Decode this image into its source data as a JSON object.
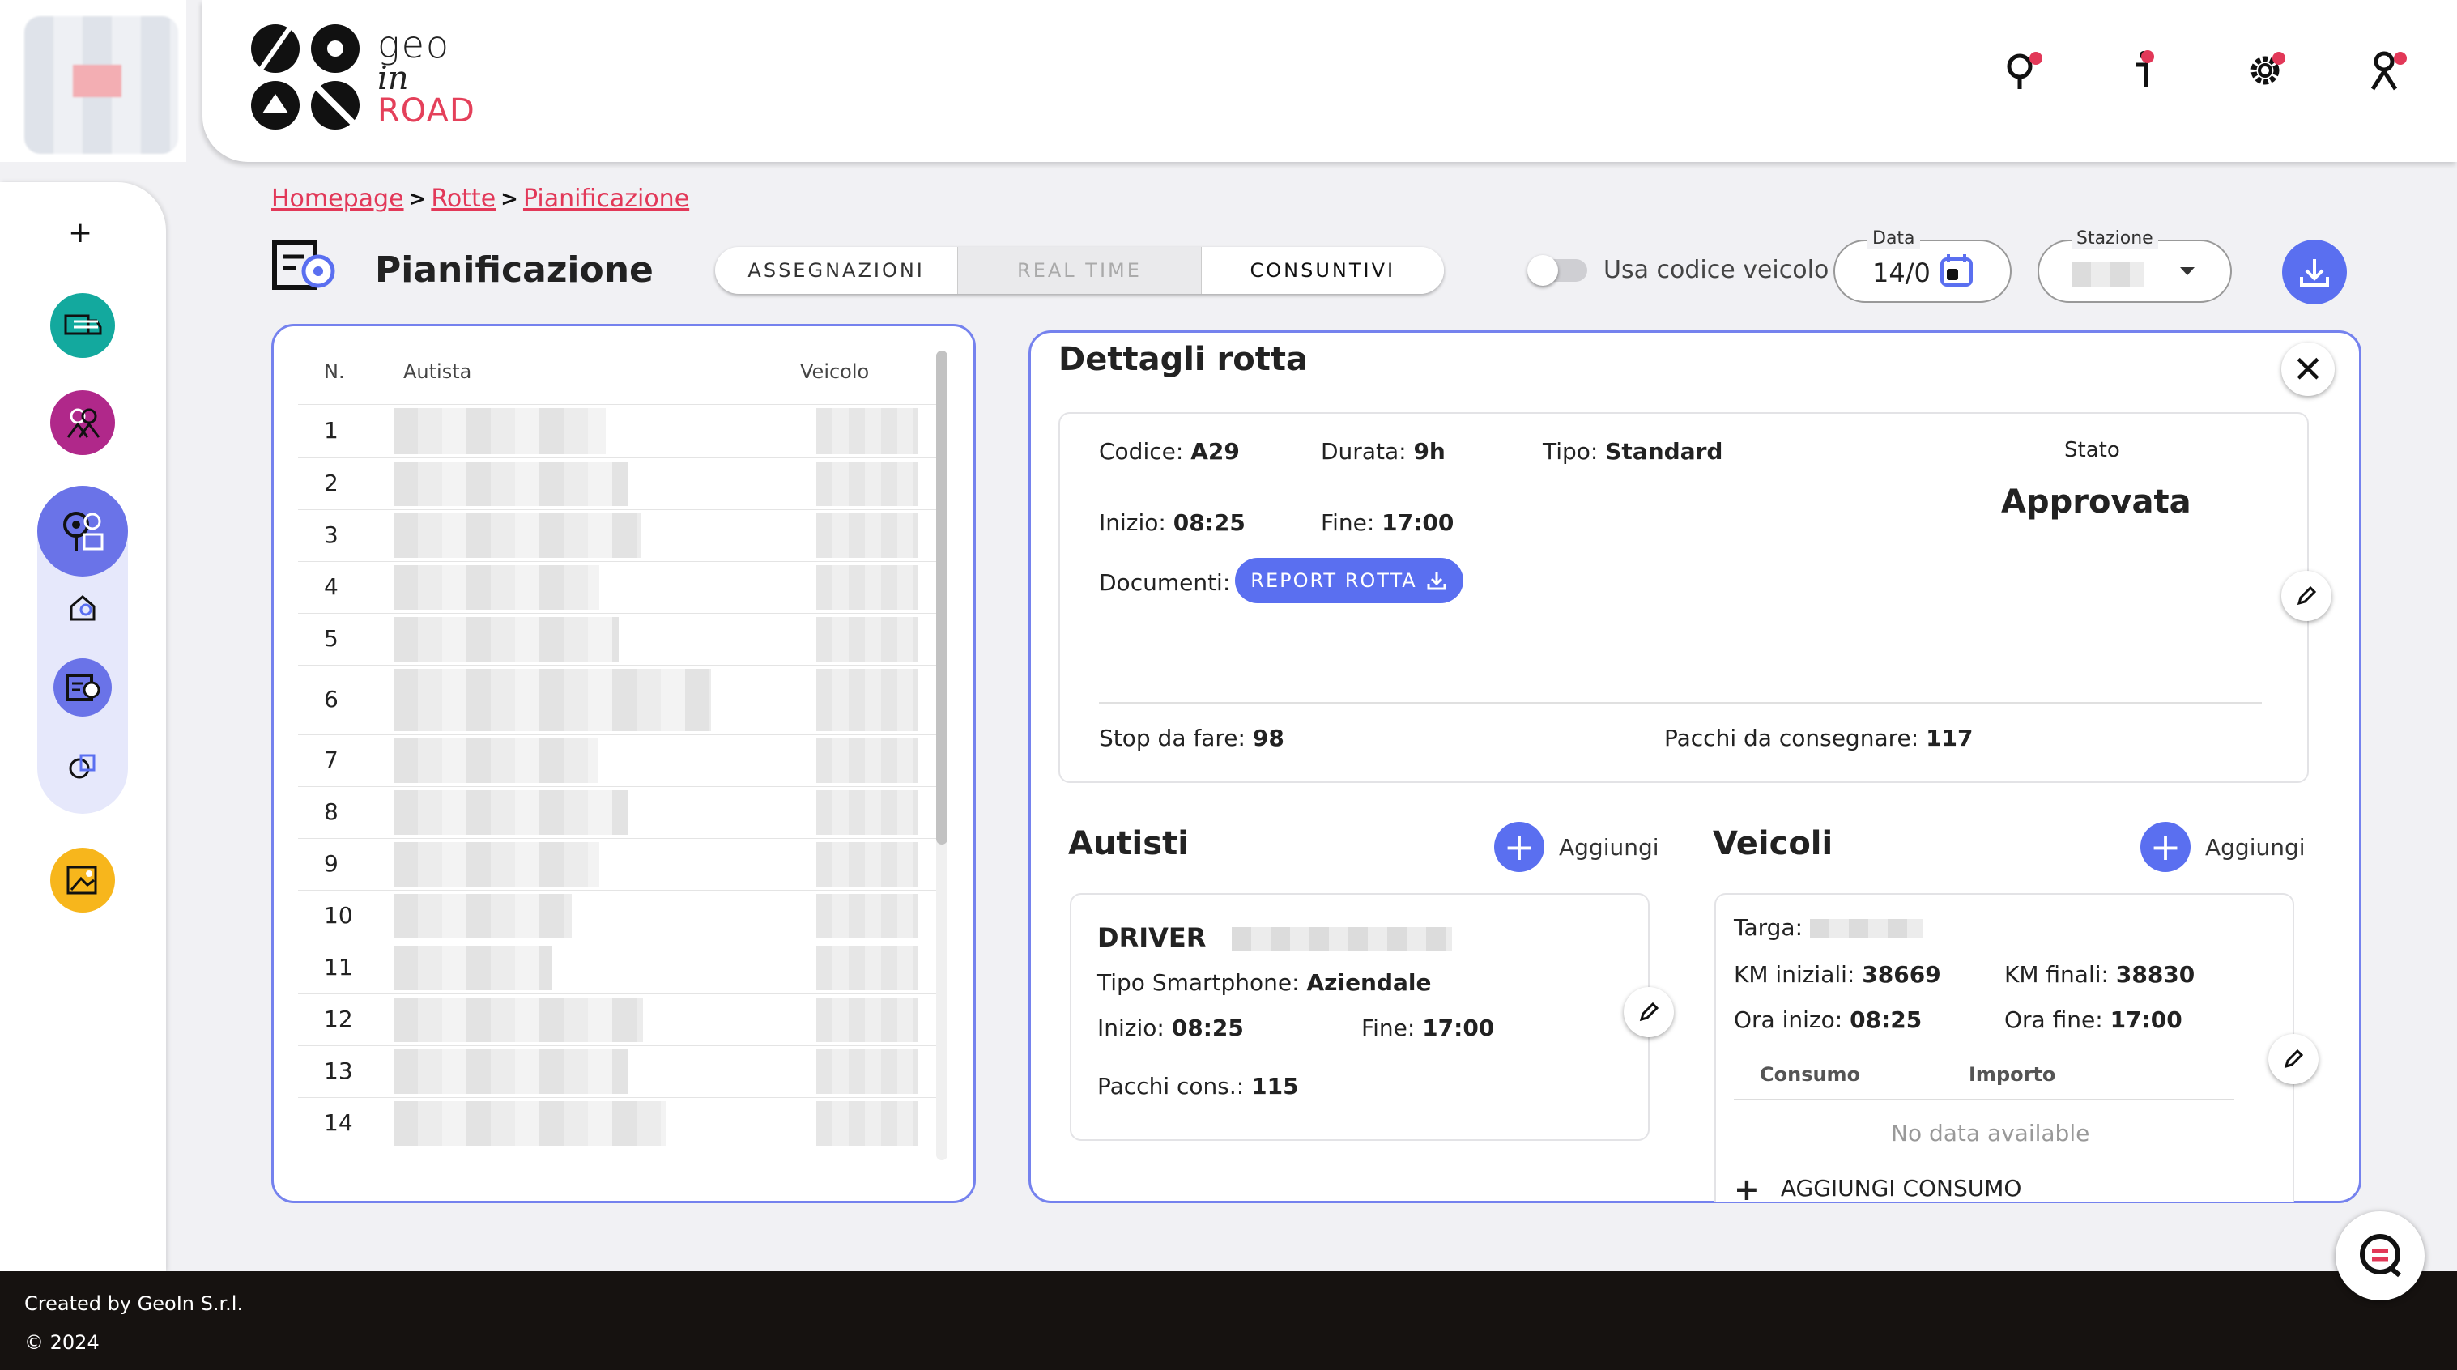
{
  "brand": {
    "geo": "GEO",
    "in": "in",
    "road": "ROAD"
  },
  "header": {
    "icons": [
      "map-pin-icon",
      "info-icon",
      "settings-gear-icon",
      "user-icon"
    ]
  },
  "sidebar": {
    "plus": "+",
    "items": [
      "truck-list-icon",
      "users-icon",
      "route-planning-icon",
      "home-route-icon",
      "route-list-icon",
      "route-report-icon",
      "image-icon"
    ]
  },
  "breadcrumb": {
    "items": [
      "Homepage",
      "Rotte",
      "Pianificazione"
    ],
    "separator": ">"
  },
  "page": {
    "title": "Pianificazione",
    "tabs": [
      {
        "label": "ASSEGNAZIONI",
        "state": "normal"
      },
      {
        "label": "REAL TIME",
        "state": "disabled"
      },
      {
        "label": "CONSUNTIVI",
        "state": "active"
      }
    ],
    "toggle_label": "Usa codice veicolo",
    "date": {
      "label": "Data",
      "value": "14/0"
    },
    "station": {
      "label": "Stazione",
      "value": ""
    }
  },
  "table": {
    "headers": {
      "n": "N.",
      "driver": "Autista",
      "vehicle": "Veicolo"
    },
    "rows": [
      "1",
      "2",
      "3",
      "4",
      "5",
      "6",
      "7",
      "8",
      "9",
      "10",
      "11",
      "12",
      "13",
      "14"
    ]
  },
  "details": {
    "title": "Dettagli rotta",
    "code_label": "Codice:",
    "code": "A29",
    "duration_label": "Durata:",
    "duration": "9h",
    "type_label": "Tipo:",
    "type": "Standard",
    "status_label": "Stato",
    "status": "Approvata",
    "start_label": "Inizio:",
    "start": "08:25",
    "end_label": "Fine:",
    "end": "17:00",
    "docs_label": "Documenti:",
    "report_button": "REPORT ROTTA",
    "stops_label": "Stop da fare:",
    "stops": "98",
    "parcels_label": "Pacchi da consegnare:",
    "parcels": "117"
  },
  "drivers": {
    "title": "Autisti",
    "add_label": "Aggiungi",
    "card": {
      "role": "DRIVER",
      "phone_label": "Tipo Smartphone:",
      "phone": "Aziendale",
      "start_label": "Inizio:",
      "start": "08:25",
      "end_label": "Fine:",
      "end": "17:00",
      "parcels_label": "Pacchi cons.:",
      "parcels": "115"
    }
  },
  "vehicles": {
    "title": "Veicoli",
    "add_label": "Aggiungi",
    "card": {
      "plate_label": "Targa:",
      "km_start_label": "KM iniziali:",
      "km_start": "38669",
      "km_end_label": "KM finali:",
      "km_end": "38830",
      "time_start_label": "Ora inizo:",
      "time_start": "08:25",
      "time_end_label": "Ora fine:",
      "time_end": "17:00",
      "col_consumption": "Consumo",
      "col_amount": "Importo",
      "empty": "No data available",
      "add_consumption": "AGGIUNGI CONSUMO"
    }
  },
  "footer": {
    "created_by": "Created by GeoIn S.r.l.",
    "year": "© 2024"
  },
  "colors": {
    "accent": "#5a6ff0",
    "brand_red": "#e23858",
    "panel_border": "#7582ee",
    "footer_bg": "#161210"
  }
}
